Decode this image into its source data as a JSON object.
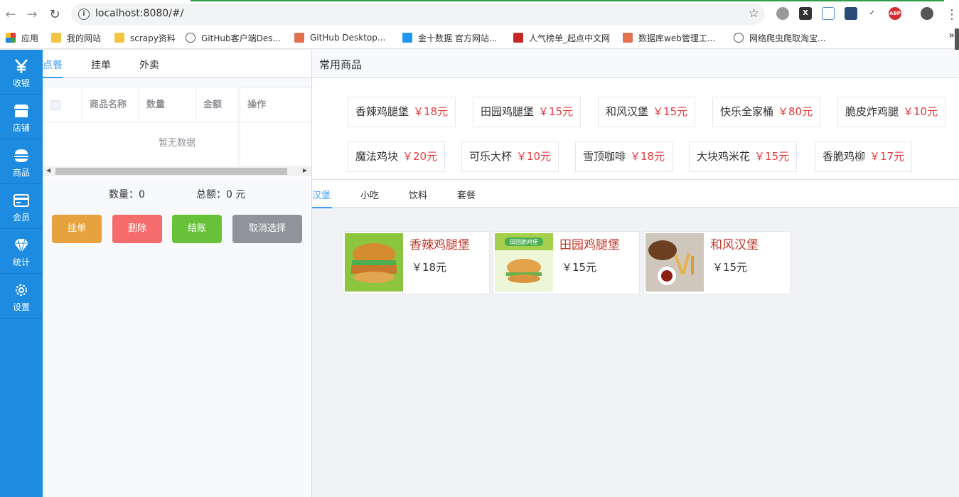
{
  "browser": {
    "url": "localhost:8080/#/",
    "bookmarks": [
      {
        "label": "应用"
      },
      {
        "label": "我的网站"
      },
      {
        "label": "scrapy资料"
      },
      {
        "label": "GitHub客户端Des..."
      },
      {
        "label": "GitHub Desktop..."
      },
      {
        "label": "金十数据 官方网站..."
      },
      {
        "label": "人气榜单_起点中文网"
      },
      {
        "label": "数据库web管理工..."
      },
      {
        "label": "网络爬虫爬取淘宝..."
      }
    ]
  },
  "leftbar": {
    "items": [
      {
        "label": "收银",
        "icon": "yen-icon"
      },
      {
        "label": "店铺",
        "icon": "shop-icon"
      },
      {
        "label": "商品",
        "icon": "burger-icon"
      },
      {
        "label": "会员",
        "icon": "card-icon"
      },
      {
        "label": "统计",
        "icon": "diamond-icon"
      },
      {
        "label": "设置",
        "icon": "gear-icon"
      }
    ]
  },
  "order": {
    "tabs": [
      "点餐",
      "挂单",
      "外卖"
    ],
    "table": {
      "headers": [
        "商品名称",
        "数量",
        "金额",
        "操作"
      ],
      "empty_text": "暂无数据"
    },
    "totals": {
      "count_label": "数量：",
      "count_value": "0",
      "sum_label": "总额：",
      "sum_value": "0 元"
    },
    "buttons": [
      {
        "label": "挂单",
        "color": "#e6a23c"
      },
      {
        "label": "删除",
        "color": "#f56c6c"
      },
      {
        "label": "结账",
        "color": "#67c23a"
      },
      {
        "label": "取消选择",
        "color": "#909399"
      }
    ]
  },
  "common": {
    "title": "常用商品",
    "items": [
      {
        "name": "香辣鸡腿堡",
        "price": "￥18元"
      },
      {
        "name": "田园鸡腿堡",
        "price": "￥15元"
      },
      {
        "name": "和风汉堡",
        "price": "￥15元"
      },
      {
        "name": "快乐全家桶",
        "price": "￥80元"
      },
      {
        "name": "脆皮炸鸡腿",
        "price": "￥10元"
      },
      {
        "name": "魔法鸡块",
        "price": "￥20元"
      },
      {
        "name": "可乐大杯",
        "price": "￥10元"
      },
      {
        "name": "雪顶咖啡",
        "price": "￥18元"
      },
      {
        "name": "大块鸡米花",
        "price": "￥15元"
      },
      {
        "name": "香脆鸡柳",
        "price": "￥17元"
      }
    ]
  },
  "categories": {
    "tabs": [
      "汉堡",
      "小吃",
      "饮料",
      "套餐"
    ],
    "goods": [
      {
        "name": "香辣鸡腿堡",
        "price": "￥18元"
      },
      {
        "name": "田园鸡腿堡",
        "price": "￥15元"
      },
      {
        "name": "和风汉堡",
        "price": "￥15元"
      }
    ],
    "banner_text": "田园脆鸡堡"
  },
  "colors": {
    "accent": "#409eff",
    "sidebar": "#1d8ce0",
    "price": "#e4393c"
  }
}
